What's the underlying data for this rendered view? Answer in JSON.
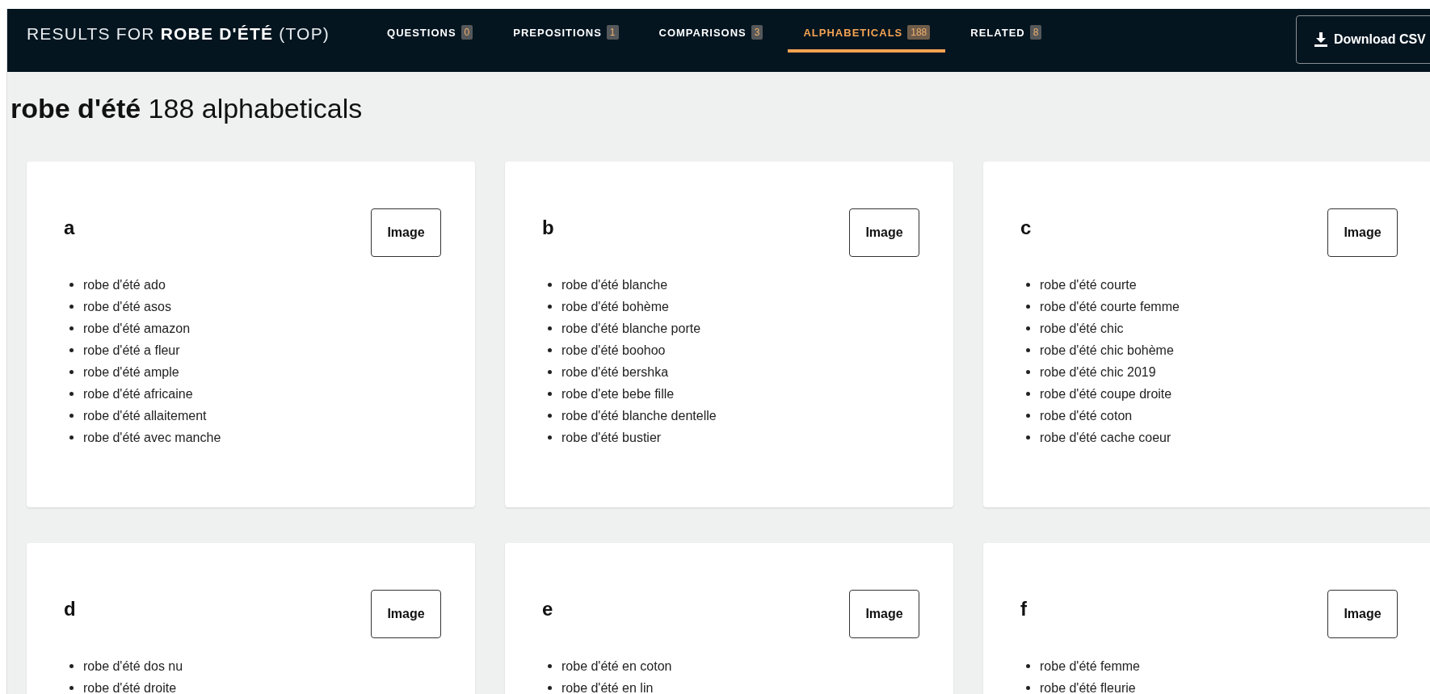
{
  "header": {
    "title": "RESULTS FOR **ROBE D'ÉTÉ** (TOP)",
    "tabs": [
      {
        "label": "QUESTIONS",
        "count": "0",
        "selected": false
      },
      {
        "label": "PREPOSITIONS",
        "count": "1",
        "selected": false
      },
      {
        "label": "COMPARISONS",
        "count": "3",
        "selected": false
      },
      {
        "label": "ALPHABETICALS",
        "count": "188",
        "selected": true
      },
      {
        "label": "RELATED",
        "count": "8",
        "selected": false
      }
    ],
    "download_button": "Download CSV"
  },
  "heading": "**robe d'été** 188 alphabeticals",
  "cards": [
    {
      "letter": "a",
      "button": "Image",
      "items": [
        "robe d'été ado",
        "robe d'été asos",
        "robe d'été amazon",
        "robe d'été a fleur",
        "robe d'été ample",
        "robe d'été africaine",
        "robe d'été allaitement",
        "robe d'été avec manche"
      ]
    },
    {
      "letter": "b",
      "button": "Image",
      "items": [
        "robe d'été blanche",
        "robe d'été bohème",
        "robe d'été blanche porte",
        "robe d'été boohoo",
        "robe d'été bershka",
        "robe d'ete bebe fille",
        "robe d'été blanche dentelle",
        "robe d'été bustier"
      ]
    },
    {
      "letter": "c",
      "button": "Image",
      "items": [
        "robe d'été courte",
        "robe d'été courte femme",
        "robe d'été chic",
        "robe d'été chic bohème",
        "robe d'été chic 2019",
        "robe d'été coupe droite",
        "robe d'été coton",
        "robe d'été cache coeur"
      ]
    },
    {
      "letter": "d",
      "button": "Image",
      "items": [
        "robe d'été dos nu",
        "robe d'été droite"
      ]
    },
    {
      "letter": "e",
      "button": "Image",
      "items": [
        "robe d'été en coton",
        "robe d'été en lin"
      ]
    },
    {
      "letter": "f",
      "button": "Image",
      "items": [
        "robe d'été femme",
        "robe d'été fleurie"
      ]
    }
  ]
}
